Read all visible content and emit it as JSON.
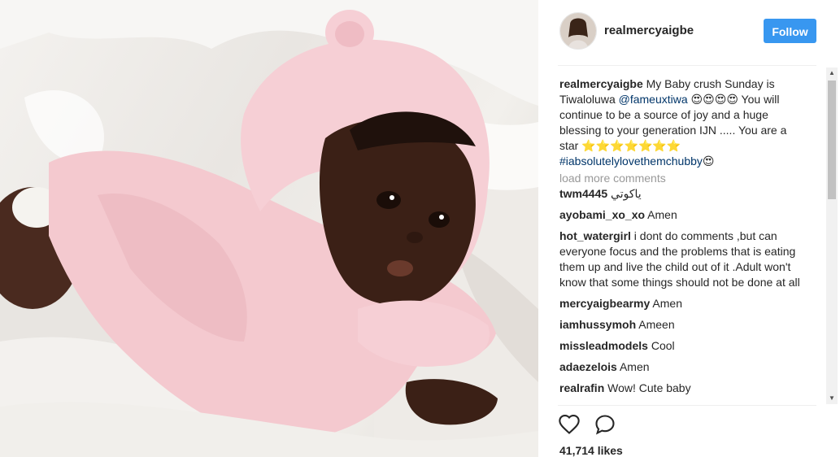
{
  "post": {
    "username": "realmercyaigbe",
    "follow_label": "Follow",
    "caption_user": "realmercyaigbe",
    "caption_text_1": " My Baby crush Sunday is Tiwaloluwa ",
    "caption_mention": "@fameuxtiwa",
    "caption_text_2": " 😍😍😍😍 You will continue to be a source of joy and a huge blessing to your generation IJN ..... You are a star ⭐⭐⭐⭐⭐⭐⭐",
    "caption_hashtag": "#iabsolutelylovethemchubby",
    "caption_text_3": "😍",
    "likes": "41,714 likes"
  },
  "load_more": "load more comments",
  "comments": [
    {
      "user": "twm4445",
      "text": " ياكوتي"
    },
    {
      "user": "ayobami_xo_xo",
      "text": " Amen"
    },
    {
      "user": "hot_watergirl",
      "text": " i dont do comments ,but can everyone focus and the problems that is eating them up and live the child out of it .Adult won't know that some things should not be done at all"
    },
    {
      "user": "mercyaigbearmy",
      "text": " Amen"
    },
    {
      "user": "iamhussymoh",
      "text": " Ameen"
    },
    {
      "user": "missleadmodels",
      "text": " Cool"
    },
    {
      "user": "adaezelois",
      "text": " Amen"
    },
    {
      "user": "realrafin",
      "text": " Wow! Cute baby"
    }
  ],
  "icons": {
    "like": "heart-icon",
    "comment": "comment-icon",
    "scroll_up": "▲",
    "scroll_down": "▼"
  },
  "colors": {
    "follow_button": "#3897f0",
    "link": "#003569",
    "muted": "#999999"
  }
}
